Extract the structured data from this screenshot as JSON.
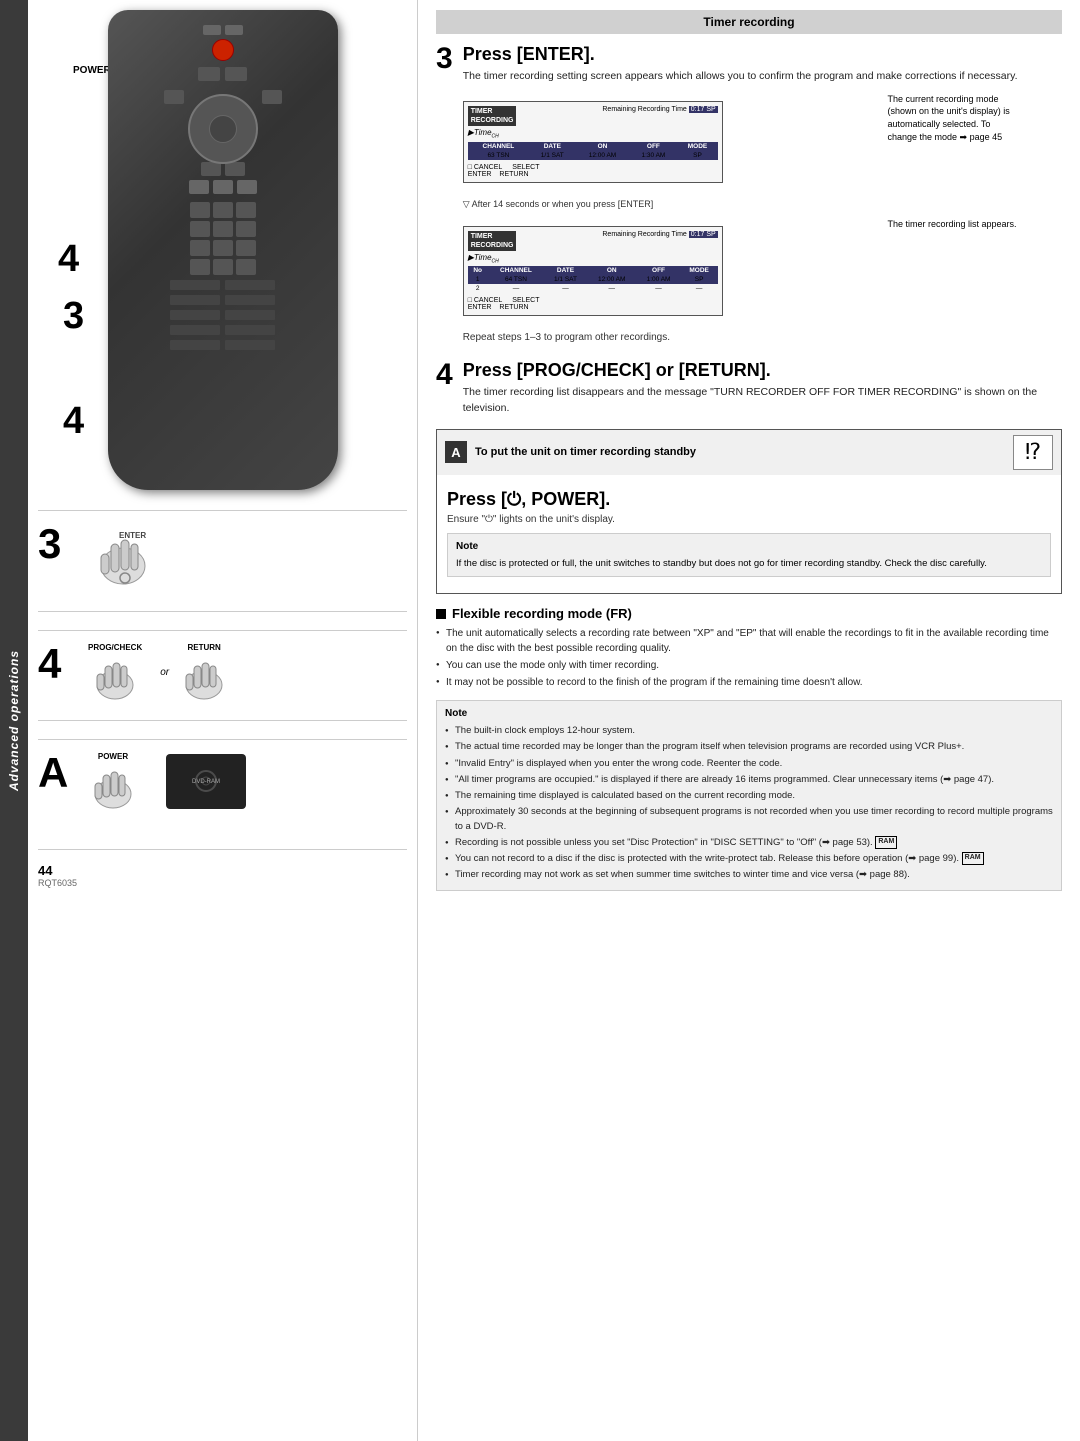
{
  "sidebar": {
    "text": "Advanced operations"
  },
  "page": {
    "number": "44",
    "code": "RQT6035"
  },
  "header": {
    "section_title": "Timer recording"
  },
  "left_panel": {
    "power_label": "POWER",
    "step3_label": "3",
    "step4a_label": "4",
    "step4b_label": "4",
    "step_a_label": "A",
    "enter_label": "ENTER",
    "prog_check_label": "PROG/CHECK",
    "or_label": "or",
    "return_label": "RETURN",
    "power_btn_label": "POWER",
    "dvd_ram_label": "DVD-RAM"
  },
  "step3": {
    "number": "3",
    "title": "Press [ENTER].",
    "body": "The timer recording setting screen appears which allows you to confirm the program and make corrections if necessary.",
    "screen1": {
      "header": "TIMER\nRECORDING",
      "remaining": "Remaining Recording Time",
      "time_badge": "0:17 SP",
      "logo": "Time",
      "columns": [
        "CHANNEL",
        "DATE",
        "ON",
        "OFF",
        "MODE"
      ],
      "row": [
        "63 TSN",
        "1/1 SAT",
        "12:00 AM",
        "1:30 AM",
        "SP"
      ],
      "cancel_label": "CANCEL",
      "select_label": "SELECT",
      "enter_label": "ENTER",
      "return_label": "RETURN"
    },
    "annotation": "The current recording mode (shown on the unit's display) is automatically selected. To change the mode ➡ page 45",
    "arrow_note": "After 14 seconds or when you press [ENTER]",
    "screen2": {
      "header": "TIMER\nRECORDING",
      "remaining": "Remaining Recording Time",
      "time_badge": "0:17 SP",
      "logo": "Time",
      "columns": [
        "No",
        "CHANNEL",
        "DATE",
        "ON",
        "OFF",
        "MODE"
      ],
      "row1": [
        "1",
        "64 TSN",
        "1/1 SAT",
        "12:00 AM",
        "1:00 AM",
        "SP"
      ],
      "row2": [
        "2",
        "—",
        "—",
        "—",
        "—",
        "—"
      ],
      "cancel_label": "CANCEL",
      "select_label": "SELECT",
      "enter_label": "ENTER",
      "return_label": "RETURN"
    },
    "screen2_note": "The timer recording list appears.",
    "repeat_note": "Repeat steps 1–3 to program other recordings."
  },
  "step4": {
    "number": "4",
    "title": "Press [PROG/CHECK] or [RETURN].",
    "body": "The timer recording list disappears and the message \"TURN RECORDER OFF FOR TIMER RECORDING\" is shown on the television."
  },
  "box_a": {
    "label": "A",
    "title": "To put the unit on timer recording standby",
    "icon_symbol": "⁉",
    "press_title": "Press [⏻, POWER].",
    "press_sub": "Ensure \"⏻\" lights on the unit's display.",
    "note_title": "Note",
    "note_body": "If the disc is protected or full, the unit switches to standby but does not go for timer recording standby. Check the disc carefully."
  },
  "flexible": {
    "title": "Flexible recording mode (FR)",
    "bullets": [
      "The unit automatically selects a recording rate between \"XP\" and \"EP\" that will enable the recordings to fit in the available recording time on the disc with the best possible recording quality.",
      "You can use the mode only with timer recording.",
      "It may not be possible to record to the finish of the program if the remaining time doesn't allow."
    ]
  },
  "bottom_note": {
    "title": "Note",
    "items": [
      "The built-in clock employs 12-hour system.",
      "The actual time recorded may be longer than the program itself when television programs are recorded using VCR Plus+.",
      "\"Invalid Entry\" is displayed when you enter the wrong code. Reenter the code.",
      "\"All timer programs are occupied.\" is displayed if there are already 16 items programmed. Clear unnecessary items (➡ page 47).",
      "The remaining time displayed is calculated based on the current recording mode.",
      "Approximately 30 seconds at the beginning of subsequent programs is not recorded when you use timer recording to record multiple programs to a DVD-R.",
      "Recording is not possible unless you set \"Disc Protection\" in \"DISC SETTING\" to \"Off\" (➡ page 53). RAM",
      "You can not record to a disc if the disc is protected with the write-protect tab. Release this before operation (➡ page 99). RAM",
      "Timer recording may not work as set when summer time switches to winter time and vice versa (➡ page 88)."
    ]
  }
}
